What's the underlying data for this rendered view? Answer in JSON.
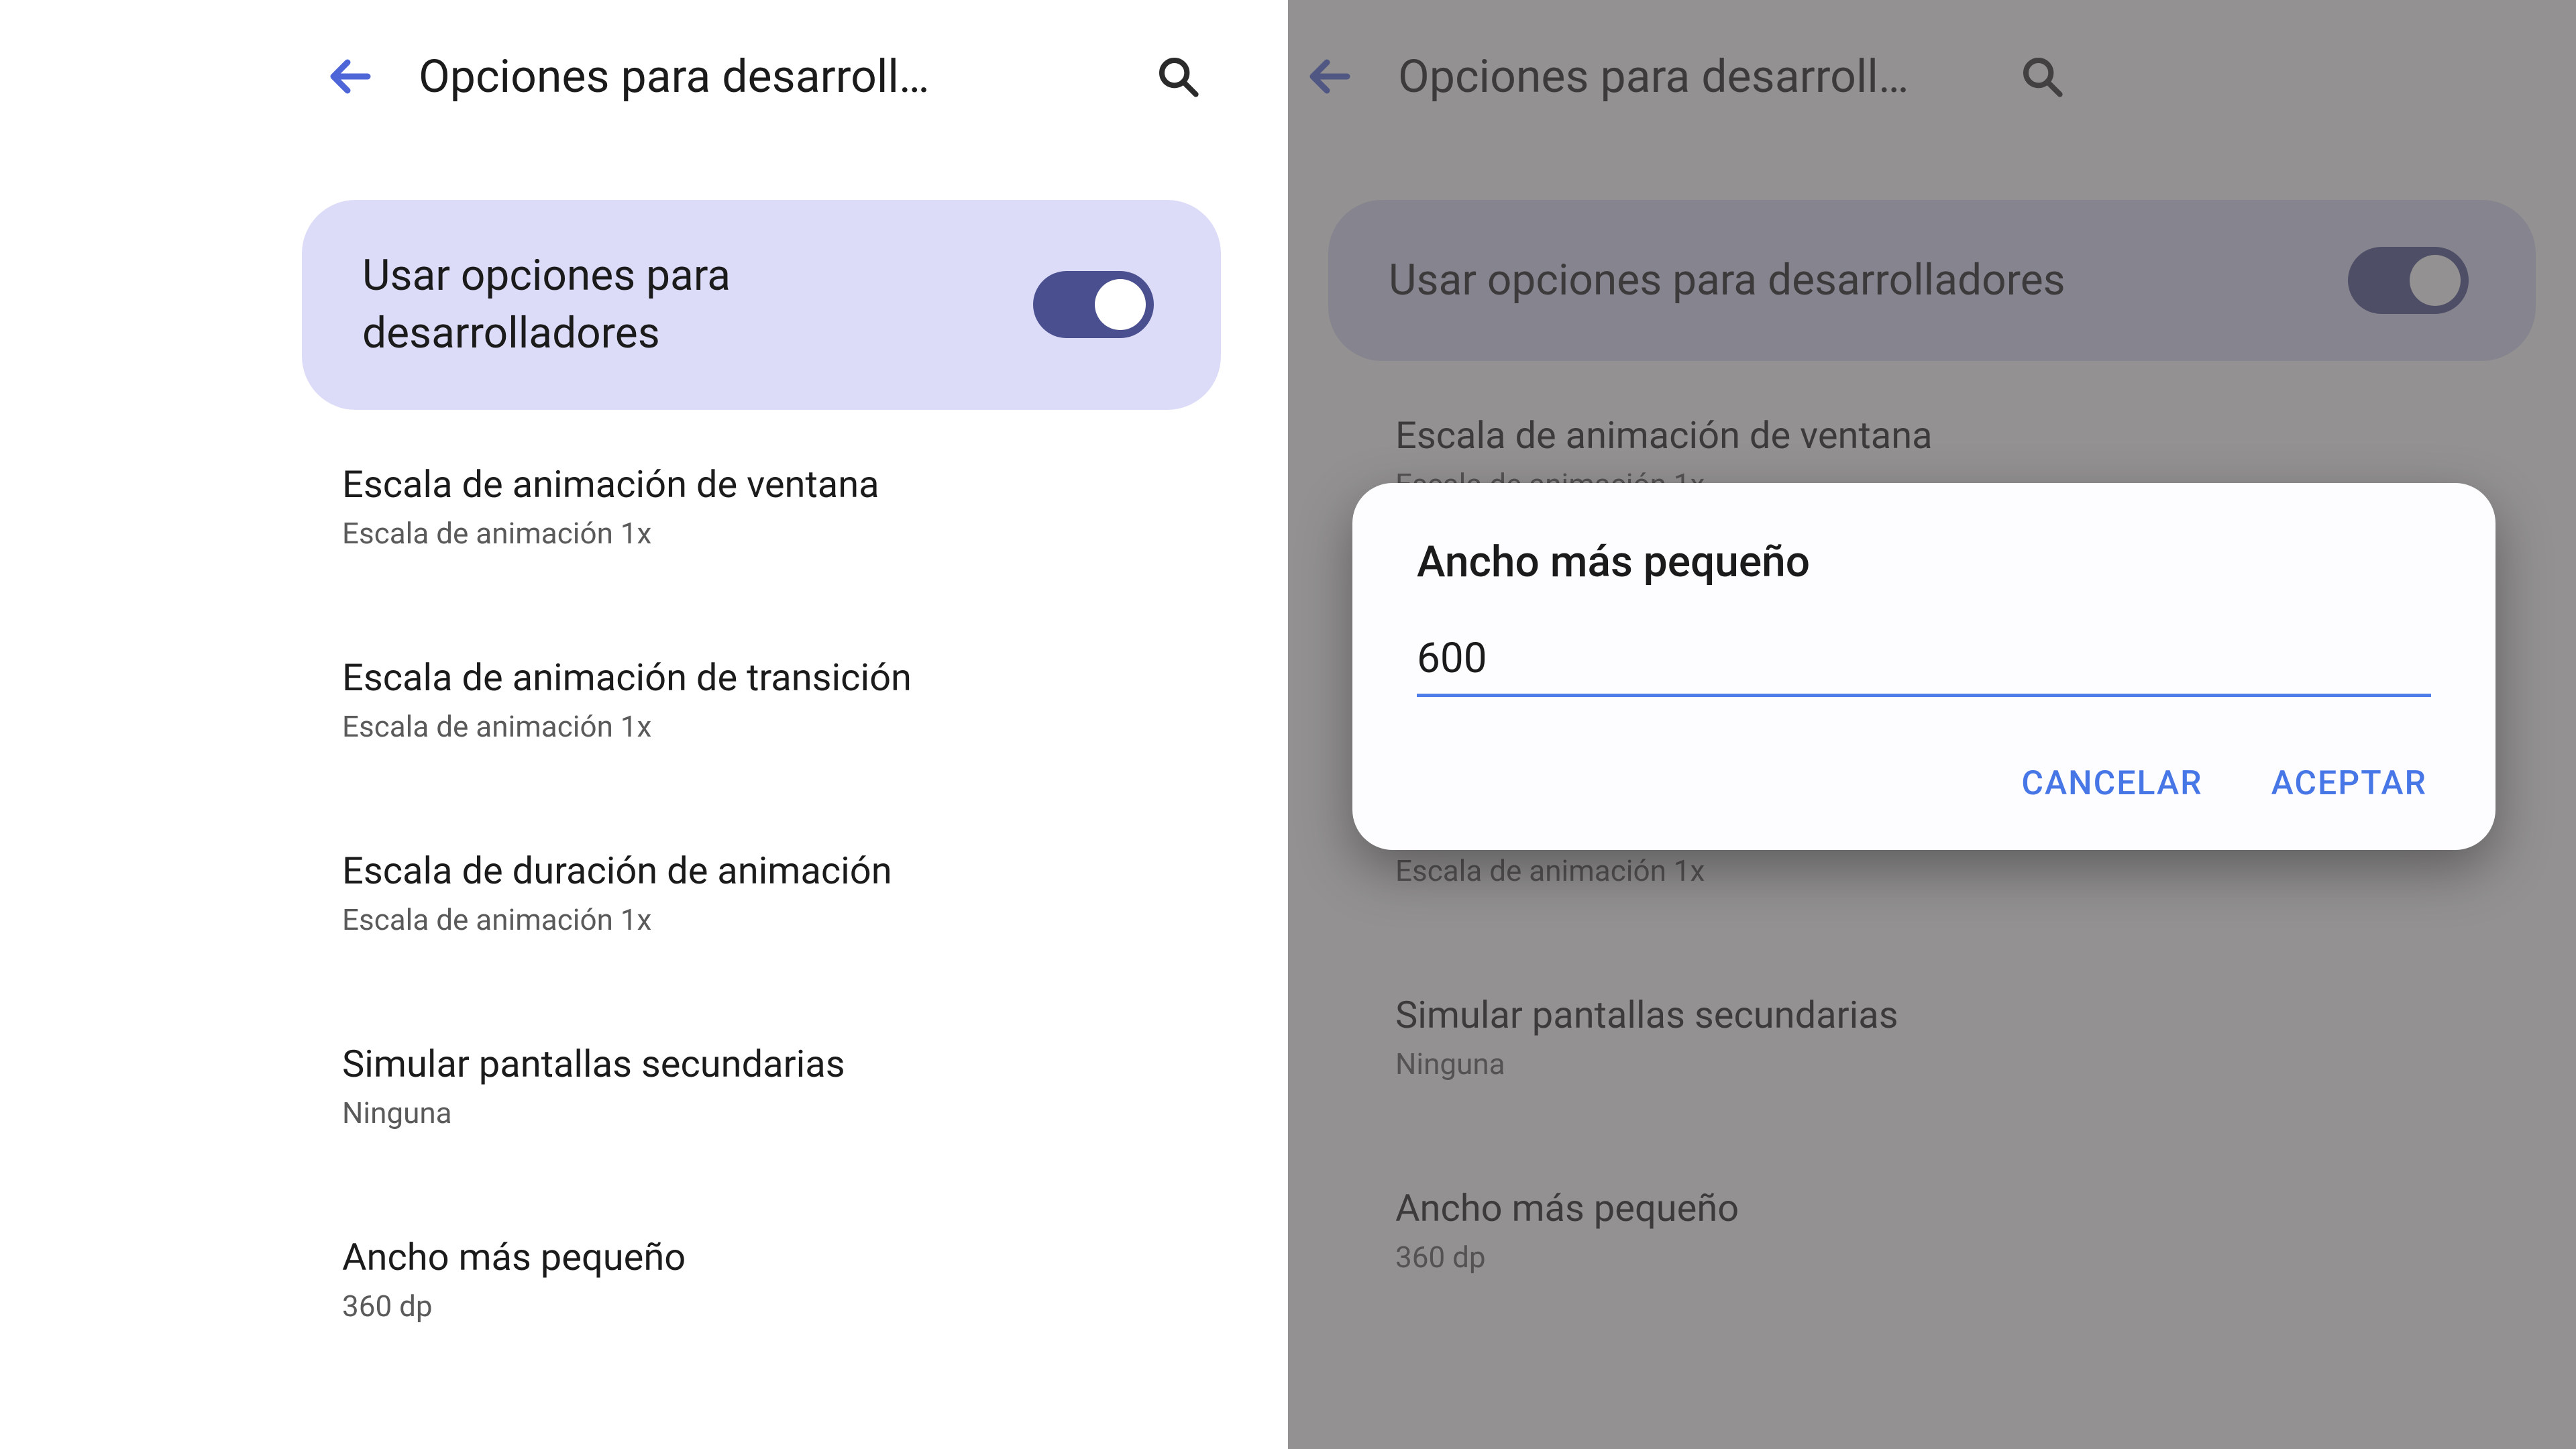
{
  "appbar": {
    "title": "Opciones para desarroll…"
  },
  "toggle": {
    "label": "Usar opciones para desarrolladores",
    "on": true
  },
  "settings": [
    {
      "title": "Escala de animación de ventana",
      "sub": "Escala de animación 1x"
    },
    {
      "title": "Escala de animación de transición",
      "sub": "Escala de animación 1x"
    },
    {
      "title": "Escala de duración de animación",
      "sub": "Escala de animación 1x"
    },
    {
      "title": "Simular pantallas secundarias",
      "sub": "Ninguna"
    },
    {
      "title": "Ancho más pequeño",
      "sub": "360 dp"
    }
  ],
  "dialog": {
    "title": "Ancho más pequeño",
    "value": "600",
    "cancel": "CANCELAR",
    "accept": "ACEPTAR"
  }
}
